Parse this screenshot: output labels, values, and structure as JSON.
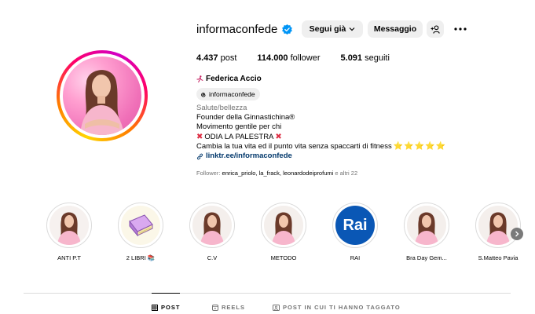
{
  "profile": {
    "username": "informaconfede",
    "verified": true,
    "buttons": {
      "follow": "Segui già",
      "message": "Messaggio"
    },
    "stats": {
      "posts_count": "4.437",
      "posts_label": "post",
      "followers_count": "114.000",
      "followers_label": "follower",
      "following_count": "5.091",
      "following_label": "seguiti"
    },
    "full_name": "Federica Accio",
    "threads_handle": "informaconfede",
    "bio": {
      "category": "Salute/bellezza",
      "line1": "Founder della Ginnastichina®",
      "line2": "Movimento gentile per chi",
      "line3": "ODIA LA PALESTRA",
      "line4": "Cambia la tua vita ed il punto vita senza spaccarti di fitness",
      "stars": "⭐⭐⭐⭐⭐",
      "link": "linktr.ee/informaconfede"
    },
    "followers_preview": {
      "prefix": "Follower:",
      "names": "enrica_priolo, la_frack, leonardodeiprofumi",
      "suffix": "e altri 22"
    }
  },
  "highlights": [
    {
      "label": "ANTI P.T",
      "icon": "person-photo"
    },
    {
      "label": "2 LIBRI 📚",
      "icon": "book-icon"
    },
    {
      "label": "C.V",
      "icon": "person-photo"
    },
    {
      "label": "METODO",
      "icon": "person-photo"
    },
    {
      "label": "RAI",
      "icon": "rai-logo"
    },
    {
      "label": "Bra Day Gem...",
      "icon": "person-photo"
    },
    {
      "label": "S.Matteo Pavia",
      "icon": "person-photo"
    }
  ],
  "rai_logo_text": "Rai",
  "tabs": {
    "posts": "POST",
    "reels": "REELS",
    "tagged": "POST IN CUI TI HANNO TAGGATO"
  },
  "colors": {
    "verified_blue": "#0095f6",
    "link_blue": "#00376b",
    "button_gray": "#efefef",
    "secondary_text": "#737373",
    "rai_blue": "#0a57b5"
  }
}
